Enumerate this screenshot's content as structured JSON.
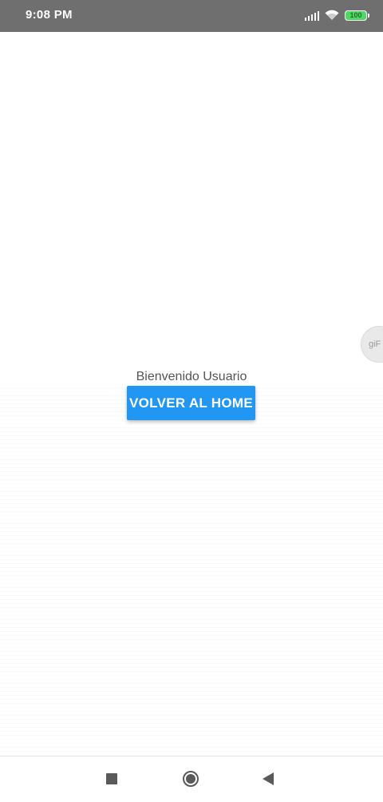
{
  "status_bar": {
    "time": "9:08 PM",
    "battery_level": "100",
    "icons": [
      "signal-icon",
      "wifi-icon",
      "battery-icon"
    ],
    "background": "#6f6f6f"
  },
  "floating_bubble": {
    "label": "giF"
  },
  "main": {
    "welcome_text": "Bienvenido Usuario",
    "home_button_label": "VOLVER AL HOME",
    "accent_color": "#2196f3"
  },
  "nav_bar": {
    "icons": [
      "recents-icon",
      "home-icon",
      "back-icon"
    ]
  }
}
